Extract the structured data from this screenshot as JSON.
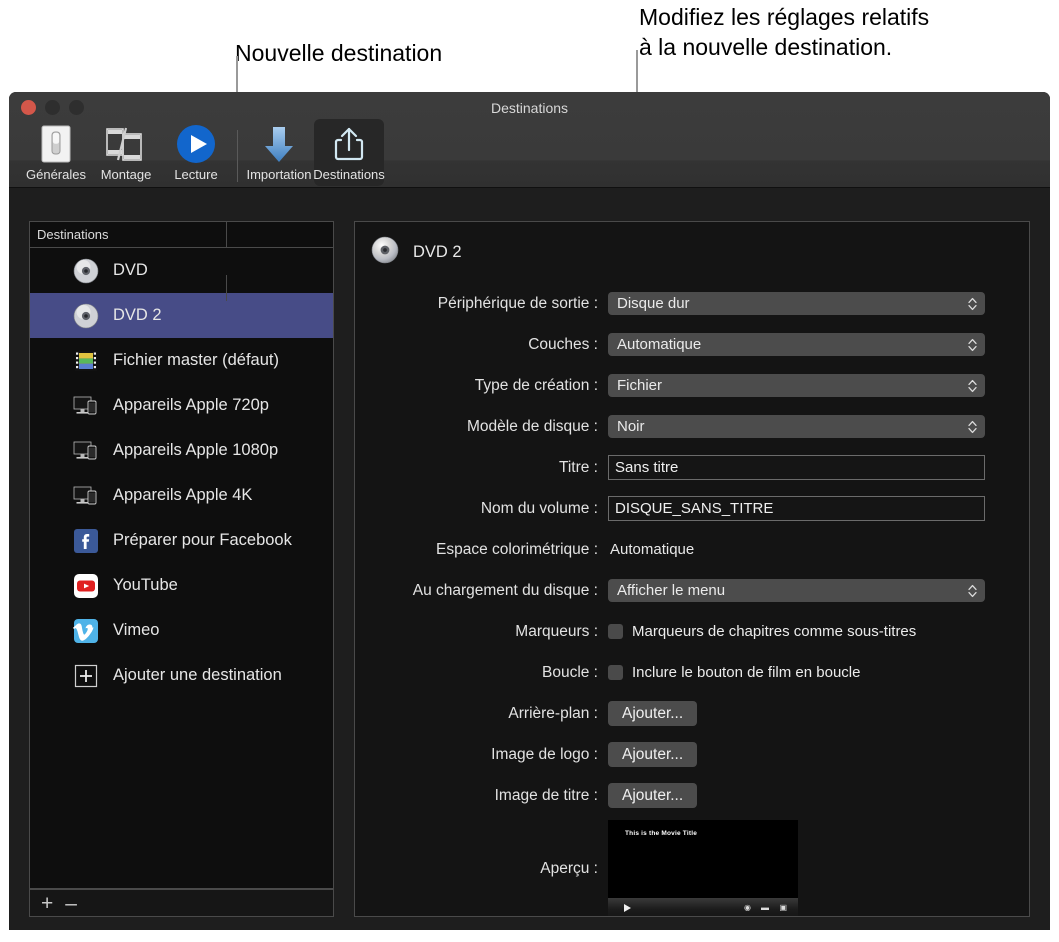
{
  "callouts": [
    {
      "text": "Nouvelle destination",
      "name": "callout-new-destination"
    },
    {
      "text": "Modifiez les réglages relatifs\nà la nouvelle destination.",
      "name": "callout-edit-settings"
    }
  ],
  "window": {
    "title": "Destinations",
    "traffic_lights": [
      "close",
      "minimize",
      "zoom"
    ]
  },
  "toolbar": {
    "items": [
      {
        "label": "Générales",
        "icon": "switch-icon",
        "selected": false
      },
      {
        "label": "Montage",
        "icon": "filmstrip-icon",
        "selected": false
      },
      {
        "label": "Lecture",
        "icon": "play-circle-icon",
        "selected": false
      },
      {
        "label": "Importation",
        "icon": "down-arrow-icon",
        "selected": false
      },
      {
        "label": "Destinations",
        "icon": "share-icon",
        "selected": true
      }
    ]
  },
  "sidebar": {
    "header": "Destinations",
    "items": [
      {
        "label": "DVD",
        "icon": "disc-icon",
        "selected": false
      },
      {
        "label": "DVD 2",
        "icon": "disc-icon",
        "selected": true
      },
      {
        "label": "Fichier master (défaut)",
        "icon": "filmreel-icon",
        "selected": false
      },
      {
        "label": "Appareils Apple 720p",
        "icon": "devices-icon",
        "selected": false
      },
      {
        "label": "Appareils Apple 1080p",
        "icon": "devices-icon",
        "selected": false
      },
      {
        "label": "Appareils Apple 4K",
        "icon": "devices-icon",
        "selected": false
      },
      {
        "label": "Préparer pour Facebook",
        "icon": "facebook-icon",
        "selected": false
      },
      {
        "label": "YouTube",
        "icon": "youtube-icon",
        "selected": false
      },
      {
        "label": "Vimeo",
        "icon": "vimeo-icon",
        "selected": false
      },
      {
        "label": "Ajouter une destination",
        "icon": "plus-box-icon",
        "selected": false
      }
    ],
    "footer": {
      "add": "+",
      "remove": "–"
    }
  },
  "detail": {
    "title": "DVD 2",
    "icon": "disc-icon",
    "fields": [
      {
        "label": "Périphérique de sortie :",
        "type": "popup",
        "value": "Disque dur"
      },
      {
        "label": "Couches :",
        "type": "popup",
        "value": "Automatique"
      },
      {
        "label": "Type de création :",
        "type": "popup",
        "value": "Fichier"
      },
      {
        "label": "Modèle de disque :",
        "type": "popup",
        "value": "Noir"
      },
      {
        "label": "Titre :",
        "type": "text",
        "value": "Sans titre"
      },
      {
        "label": "Nom du volume :",
        "type": "text",
        "value": "DISQUE_SANS_TITRE"
      },
      {
        "label": "Espace colorimétrique :",
        "type": "static",
        "value": "Automatique"
      },
      {
        "label": "Au chargement du disque :",
        "type": "popup",
        "value": "Afficher le menu"
      },
      {
        "label": "Marqueurs :",
        "type": "check",
        "value": "Marqueurs de chapitres comme sous-titres",
        "checked": false
      },
      {
        "label": "Boucle :",
        "type": "check",
        "value": "Inclure le bouton de film en boucle",
        "checked": false
      },
      {
        "label": "Arrière-plan :",
        "type": "button",
        "value": "Ajouter..."
      },
      {
        "label": "Image de logo :",
        "type": "button",
        "value": "Ajouter..."
      },
      {
        "label": "Image de titre :",
        "type": "button",
        "value": "Ajouter..."
      },
      {
        "label": "Aperçu :",
        "type": "preview",
        "value": "This is the Movie Title"
      }
    ]
  },
  "colors": {
    "selection": "#474c87",
    "window_bg": "#1e1e1e",
    "panel_bg": "#141414",
    "sidebar_bg": "#0e0e0e",
    "control_bg": "#4c4c4c",
    "accent_blue": "#5b9bd5"
  }
}
